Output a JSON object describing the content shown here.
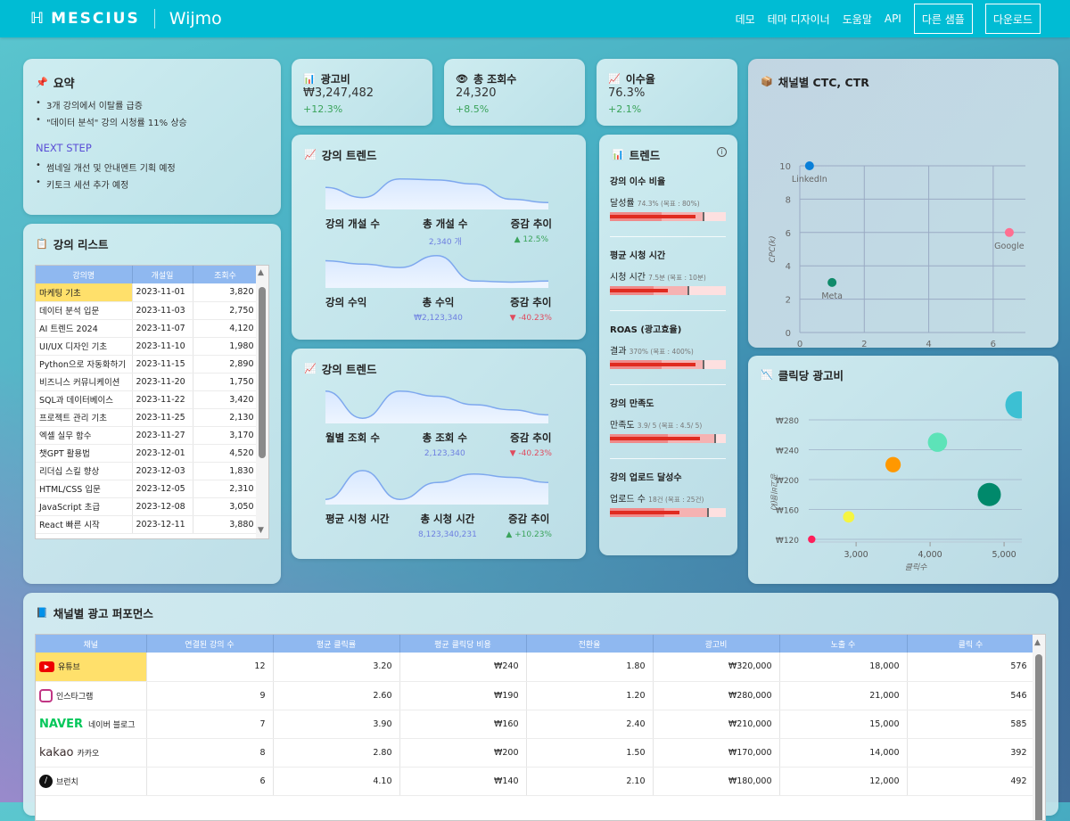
{
  "header": {
    "brand": "MESCIUS",
    "product": "Wijmo",
    "nav": [
      "데모",
      "테마 디자이너",
      "도움말",
      "API"
    ],
    "buttons": [
      "다른 샘플",
      "다운로드"
    ]
  },
  "summary": {
    "title": "요약",
    "icon": "pushpin-icon",
    "items": [
      "3개 강의에서 이탈률 급증",
      "\"데이터 분석\" 강의 시청률 11% 상승"
    ],
    "next_title": "NEXT STEP",
    "next_items": [
      "썸네일 개선 및 안내멘트 기획 예정",
      "키토크 세션 추가 예정"
    ]
  },
  "kpis": [
    {
      "title": "광고비",
      "icon": "bar-chart-icon",
      "value": "₩3,247,482",
      "delta": "+12.3%"
    },
    {
      "title": "총 조회수",
      "icon": "eye-icon",
      "value": "24,320",
      "delta": "+8.5%"
    },
    {
      "title": "이수율",
      "icon": "line-chart-icon",
      "value": "76.3%",
      "delta": "+2.1%"
    }
  ],
  "course_list": {
    "title": "강의 리스트",
    "columns": [
      "강의명",
      "개설일",
      "조회수"
    ],
    "rows": [
      [
        "마케팅 기초",
        "2023-11-01",
        "3,820"
      ],
      [
        "데이터 분석 입문",
        "2023-11-03",
        "2,750"
      ],
      [
        "AI 트렌드 2024",
        "2023-11-07",
        "4,120"
      ],
      [
        "UI/UX 디자인 기초",
        "2023-11-10",
        "1,980"
      ],
      [
        "Python으로 자동화하기",
        "2023-11-15",
        "2,890"
      ],
      [
        "비즈니스 커뮤니케이션",
        "2023-11-20",
        "1,750"
      ],
      [
        "SQL과 데이터베이스",
        "2023-11-22",
        "3,420"
      ],
      [
        "프로젝트 관리 기초",
        "2023-11-25",
        "2,130"
      ],
      [
        "엑셀 실무 함수",
        "2023-11-27",
        "3,170"
      ],
      [
        "챗GPT 활용법",
        "2023-12-01",
        "4,520"
      ],
      [
        "리더십 스킬 향상",
        "2023-12-03",
        "1,830"
      ],
      [
        "HTML/CSS 입문",
        "2023-12-05",
        "2,310"
      ],
      [
        "JavaScript 초급",
        "2023-12-08",
        "3,050"
      ],
      [
        "React 빠른 시작",
        "2023-12-11",
        "3,880"
      ]
    ]
  },
  "trend1": {
    "title": "강의 트렌드",
    "rows": [
      {
        "label": "강의 개설 수",
        "total_label": "총 개설 수",
        "total": "2,340 개",
        "change_label": "증감 추이",
        "change": "▲ 12.5%",
        "dir": "up",
        "spark": [
          60,
          30,
          85,
          82,
          70,
          25,
          15
        ]
      },
      {
        "label": "강의 수익",
        "total_label": "총 수익",
        "total": "₩2,123,340",
        "change_label": "증감 추이",
        "change": "▼ -40.23%",
        "dir": "down",
        "spark": [
          75,
          65,
          55,
          90,
          15,
          12,
          15
        ]
      }
    ]
  },
  "trend2": {
    "title": "강의 트렌드",
    "rows": [
      {
        "label": "월별 조회 수",
        "total_label": "총 조회 수",
        "total": "2,123,340",
        "change_label": "증감 추이",
        "change": "▼ -40.23%",
        "dir": "down",
        "spark": [
          90,
          10,
          90,
          75,
          50,
          35,
          20
        ]
      },
      {
        "label": "평균 시청 시간",
        "total_label": "총 시청 시간",
        "total": "8,123,340,231",
        "change_label": "증감 추이",
        "change": "▲ +10.23%",
        "dir": "up",
        "spark": [
          10,
          95,
          10,
          60,
          85,
          75,
          60
        ]
      }
    ]
  },
  "bullets": {
    "title": "트렌드",
    "items": [
      {
        "title": "강의 이수 비율",
        "label": "달성률",
        "detail": "74.3% (목표 : 80%)",
        "actual": 0.74,
        "target": 0.8,
        "range": 0.81
      },
      {
        "title": "평균 시청 시간",
        "label": "시청 시간",
        "detail": "7.5분 (목표 : 10분)",
        "actual": 0.5,
        "target": 0.67,
        "range": 0.68
      },
      {
        "title": "ROAS (광고효율)",
        "label": "결과",
        "detail": "370% (목표 : 400%)",
        "actual": 0.74,
        "target": 0.8,
        "range": 0.81
      },
      {
        "title": "강의 만족도",
        "label": "만족도",
        "detail": "3.9/ 5 (목표 : 4.5/ 5)",
        "actual": 0.78,
        "target": 0.9,
        "range": 0.91
      },
      {
        "title": "강의 업로드 달성수",
        "label": "업로드 수",
        "detail": "18건 (목표 : 25건)",
        "actual": 0.6,
        "target": 0.84,
        "range": 0.85
      }
    ]
  },
  "chart_data": [
    {
      "type": "scatter",
      "title": "채널별 CTC, CTR",
      "xlabel": "CTR",
      "ylabel": "CPC(k)",
      "xlim": [
        0,
        7
      ],
      "ylim": [
        0,
        10
      ],
      "xticks": [
        "0",
        "2",
        "4",
        "6"
      ],
      "yticks": [
        "0",
        "2",
        "4",
        "6",
        "8",
        "10"
      ],
      "points": [
        {
          "name": "LinkedIn",
          "x": 0.3,
          "y": 10,
          "color": "#0a7fd8"
        },
        {
          "name": "Meta",
          "x": 1,
          "y": 3,
          "color": "#108a6a"
        },
        {
          "name": "Google",
          "x": 6.5,
          "y": 6,
          "color": "#ff6f91"
        }
      ]
    },
    {
      "type": "bubble",
      "title": "클릭당 광고비",
      "xlabel": "클릭수",
      "ylabel": "광고비용(k)",
      "xlim": [
        2360,
        5240
      ],
      "ylim": [
        120,
        300
      ],
      "xticks": [
        "3,000",
        "4,000",
        "5,000"
      ],
      "yticks": [
        "₩120",
        "₩160",
        "₩200",
        "₩240",
        "₩280"
      ],
      "points": [
        {
          "x": 2400,
          "y": 120,
          "size": 1,
          "color": "#ff1f5a"
        },
        {
          "x": 2900,
          "y": 150,
          "size": 2,
          "color": "#f5f542"
        },
        {
          "x": 3500,
          "y": 220,
          "size": 3,
          "color": "#ff9800"
        },
        {
          "x": 4100,
          "y": 250,
          "size": 4,
          "color": "#5de3b8"
        },
        {
          "x": 4800,
          "y": 180,
          "size": 5,
          "color": "#00896b"
        },
        {
          "x": 5200,
          "y": 300,
          "size": 6,
          "color": "#3cc0d3"
        }
      ]
    }
  ],
  "ad_perf": {
    "title": "채널별 광고 퍼포먼스",
    "columns": [
      "채널",
      "연결된 강의 수",
      "평균 클릭률",
      "평균 클릭당 비용",
      "전환율",
      "광고비",
      "노출 수",
      "클릭 수"
    ],
    "rows": [
      {
        "logo": "youtube",
        "name": "유튜브",
        "cells": [
          "12",
          "3.20",
          "₩240",
          "1.80",
          "₩320,000",
          "18,000",
          "576"
        ]
      },
      {
        "logo": "instagram",
        "name": "인스타그램",
        "cells": [
          "9",
          "2.60",
          "₩190",
          "1.20",
          "₩280,000",
          "21,000",
          "546"
        ]
      },
      {
        "logo": "naver",
        "logo_text": "NAVER",
        "name": "네이버 블로그",
        "cells": [
          "7",
          "3.90",
          "₩160",
          "2.40",
          "₩210,000",
          "15,000",
          "585"
        ]
      },
      {
        "logo": "kakao",
        "logo_text": "kakao",
        "name": "카카오",
        "cells": [
          "8",
          "2.80",
          "₩200",
          "1.50",
          "₩170,000",
          "14,000",
          "392"
        ]
      },
      {
        "logo": "brunch",
        "name": "브런치",
        "cells": [
          "6",
          "4.10",
          "₩140",
          "2.10",
          "₩180,000",
          "12,000",
          "492"
        ]
      }
    ]
  }
}
